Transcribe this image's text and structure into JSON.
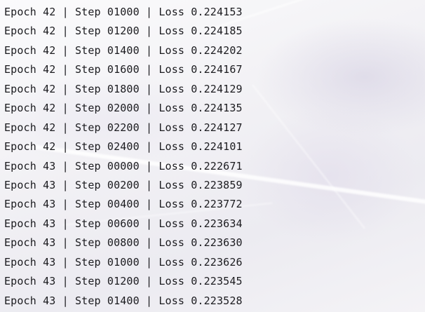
{
  "log": {
    "lines": [
      "Epoch 42 | Step 01000 | Loss 0.224153",
      "Epoch 42 | Step 01200 | Loss 0.224185",
      "Epoch 42 | Step 01400 | Loss 0.224202",
      "Epoch 42 | Step 01600 | Loss 0.224167",
      "Epoch 42 | Step 01800 | Loss 0.224129",
      "Epoch 42 | Step 02000 | Loss 0.224135",
      "Epoch 42 | Step 02200 | Loss 0.224127",
      "Epoch 42 | Step 02400 | Loss 0.224101",
      "Epoch 43 | Step 00000 | Loss 0.222671",
      "Epoch 43 | Step 00200 | Loss 0.223859",
      "Epoch 43 | Step 00400 | Loss 0.223772",
      "Epoch 43 | Step 00600 | Loss 0.223634",
      "Epoch 43 | Step 00800 | Loss 0.223630",
      "Epoch 43 | Step 01000 | Loss 0.223626",
      "Epoch 43 | Step 01200 | Loss 0.223545",
      "Epoch 43 | Step 01400 | Loss 0.223528"
    ]
  },
  "colors": {
    "text": "#1b1b1f",
    "background": "#f6f5f8"
  }
}
